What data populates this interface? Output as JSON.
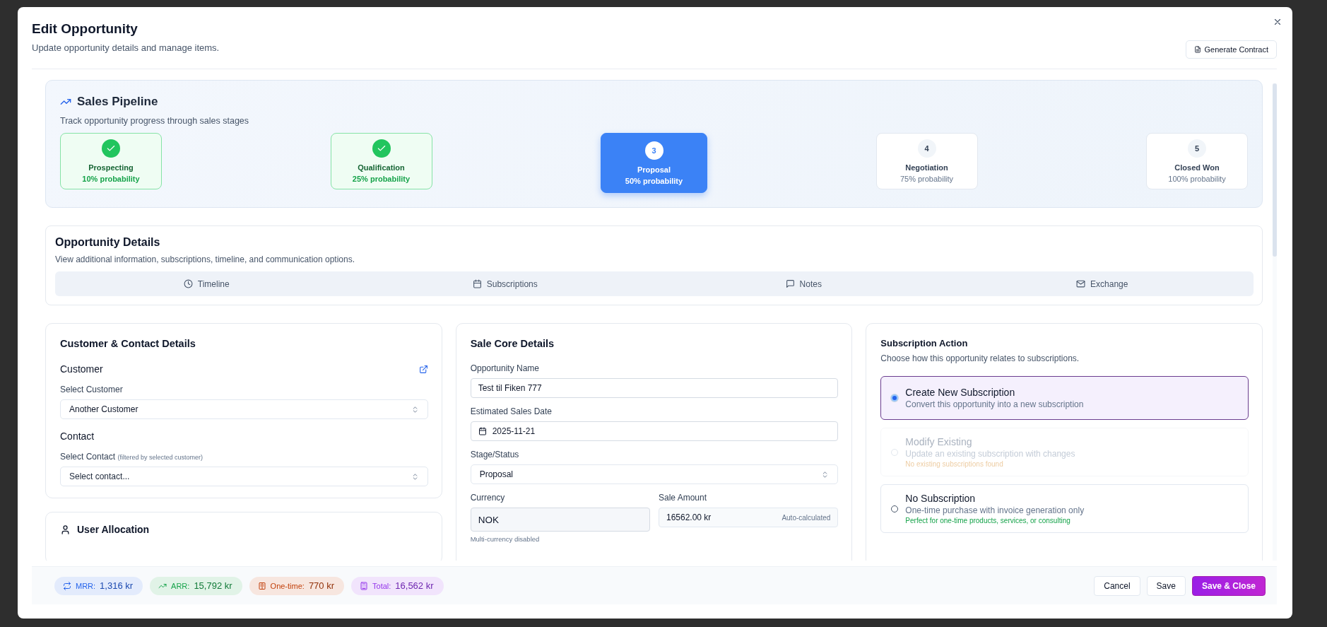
{
  "dialog": {
    "title": "Edit Opportunity",
    "subtitle": "Update opportunity details and manage items.",
    "action_button": "Generate Contract"
  },
  "pipeline": {
    "title": "Sales Pipeline",
    "subtitle": "Track opportunity progress through sales stages",
    "stages": [
      {
        "name": "Prospecting",
        "probability": "10% probability",
        "completed": true,
        "selected": false
      },
      {
        "name": "Qualification",
        "probability": "25% probability",
        "completed": true,
        "selected": false
      },
      {
        "number": "3",
        "name": "Proposal",
        "probability": "50% probability",
        "completed": false,
        "selected": true
      },
      {
        "number": "4",
        "name": "Negotiation",
        "probability": "75% probability",
        "completed": false,
        "selected": false
      },
      {
        "number": "5",
        "name": "Closed Won",
        "probability": "100% probability",
        "completed": false,
        "selected": false
      }
    ]
  },
  "opportunity_details": {
    "title": "Opportunity Details",
    "subtitle": "View additional information, subscriptions, timeline, and communication options.",
    "tabs": [
      {
        "label": "Timeline",
        "selected": false
      },
      {
        "label": "Subscriptions",
        "selected": false
      },
      {
        "label": "Notes",
        "selected": false
      },
      {
        "label": "Exchange",
        "selected": false
      }
    ]
  },
  "customer_contact": {
    "title": "Customer & Contact Details",
    "customer_heading": "Customer",
    "customer_label": "Select Customer",
    "customer_value": "Another Customer",
    "contact_heading": "Contact",
    "contact_label": "Select Contact",
    "contact_hint": "(filtered by selected customer)",
    "contact_placeholder": "Select contact..."
  },
  "user_allocation": {
    "title": "User Allocation"
  },
  "sale_core": {
    "title": "Sale Core Details",
    "name_label": "Opportunity Name",
    "name_value": "Test til Fiken 777",
    "date_label": "Estimated Sales Date",
    "date_value": "2025-11-21",
    "stage_label": "Stage/Status",
    "stage_value": "Proposal",
    "currency_label": "Currency",
    "currency_value": "NOK",
    "currency_help": "Multi-currency disabled",
    "amount_label": "Sale Amount",
    "amount_value": "16562.00 kr",
    "amount_suffix": "Auto-calculated"
  },
  "subscription_action": {
    "title": "Subscription Action",
    "subtitle": "Choose how this opportunity relates to subscriptions.",
    "options": [
      {
        "title": "Create New Subscription",
        "description": "Convert this opportunity into a new subscription",
        "selected": true,
        "disabled": false
      },
      {
        "title": "Modify Existing",
        "description": "Update an existing subscription with changes",
        "note": "No existing subscriptions found",
        "selected": false,
        "disabled": true
      },
      {
        "title": "No Subscription",
        "description": "One-time purchase with invoice generation only",
        "note": "Perfect for one-time products, services, or consulting",
        "selected": false,
        "disabled": false
      }
    ]
  },
  "footer": {
    "totals": [
      {
        "label": "MRR:",
        "value": "1,316 kr",
        "color": "#2563eb"
      },
      {
        "label": "ARR:",
        "value": "15,792 kr",
        "color": "#16a34a"
      },
      {
        "label": "One-time:",
        "value": "770 kr",
        "color": "#c2410c"
      },
      {
        "label": "Total:",
        "value": "16,562 kr",
        "color": "#9333ea"
      }
    ],
    "buttons": [
      {
        "label": "Cancel",
        "kind": "outline"
      },
      {
        "label": "Save",
        "kind": "outline"
      },
      {
        "label": "Save & Close",
        "kind": "primary"
      }
    ]
  }
}
